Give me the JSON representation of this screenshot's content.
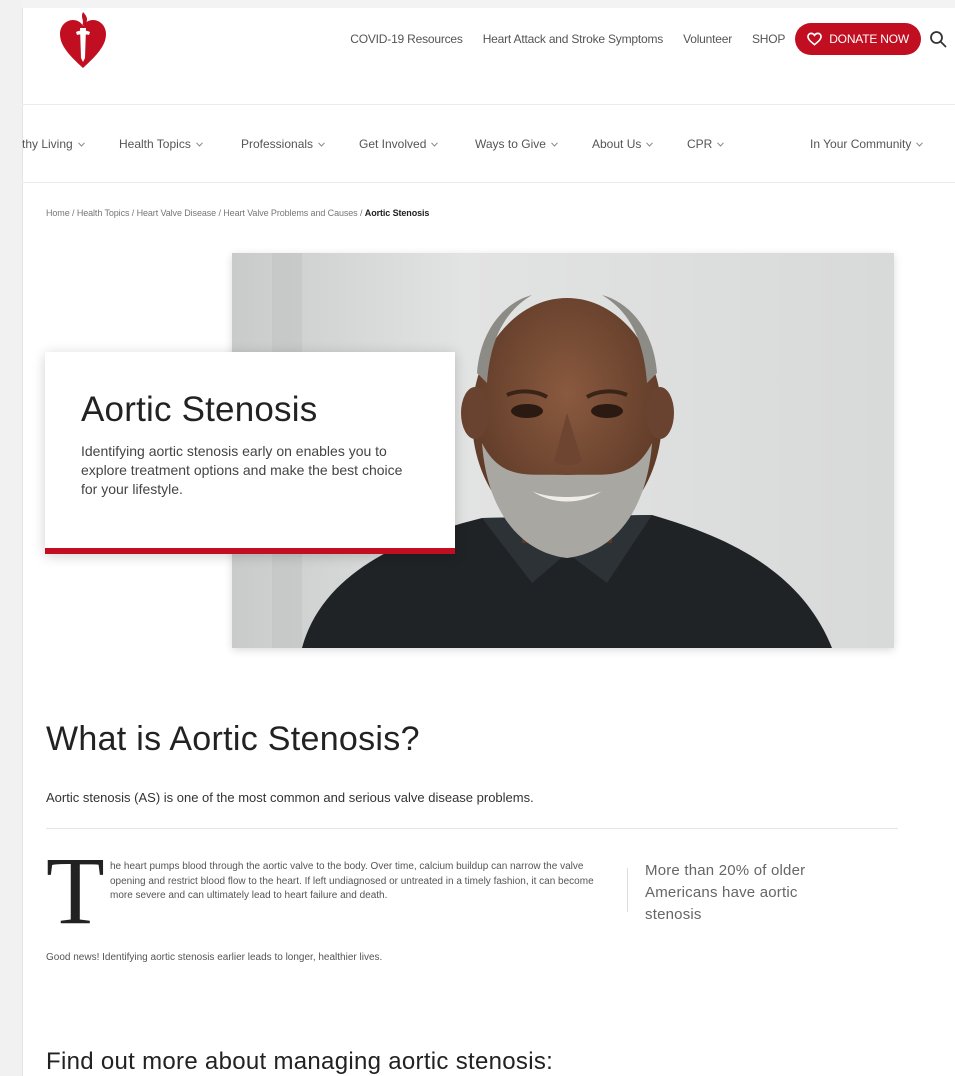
{
  "brand": {
    "accent": "#c10e21",
    "logo_icon": "heart-torch-logo-icon"
  },
  "utility_nav": {
    "links": [
      "COVID-19 Resources",
      "Heart Attack and Stroke Symptoms",
      "Volunteer",
      "SHOP"
    ],
    "donate_label": "DONATE NOW",
    "search_icon": "search-icon"
  },
  "main_nav": {
    "items": [
      "thy Living",
      "Health Topics",
      "Professionals",
      "Get Involved",
      "Ways to Give",
      "About Us",
      "CPR",
      "In Your Community"
    ]
  },
  "breadcrumb": {
    "links": [
      "Home",
      "Health Topics",
      "Heart Valve Disease",
      "Heart Valve Problems and Causes"
    ],
    "separator": " / ",
    "current": "Aortic Stenosis"
  },
  "hero": {
    "title": "Aortic Stenosis",
    "text": "Identifying aortic stenosis early on enables you to explore treatment options and make the best choice for your lifestyle."
  },
  "article": {
    "heading": "What is Aortic Stenosis?",
    "lead": "Aortic stenosis (AS) is one of the most common and serious valve disease problems.",
    "dropcap": "T",
    "body": "he heart pumps blood through the aortic valve to the body. Over time, calcium buildup can narrow the valve opening and restrict blood flow to the heart. If left undiagnosed or untreated in a timely fashion, it can become more severe and can ultimately lead to heart failure and death.",
    "stat": "More than 20% of older Americans have aortic stenosis",
    "good_news": "Good news! Identifying aortic stenosis earlier leads to longer, healthier lives.",
    "subheading": "Find out more about managing aortic stenosis:"
  }
}
